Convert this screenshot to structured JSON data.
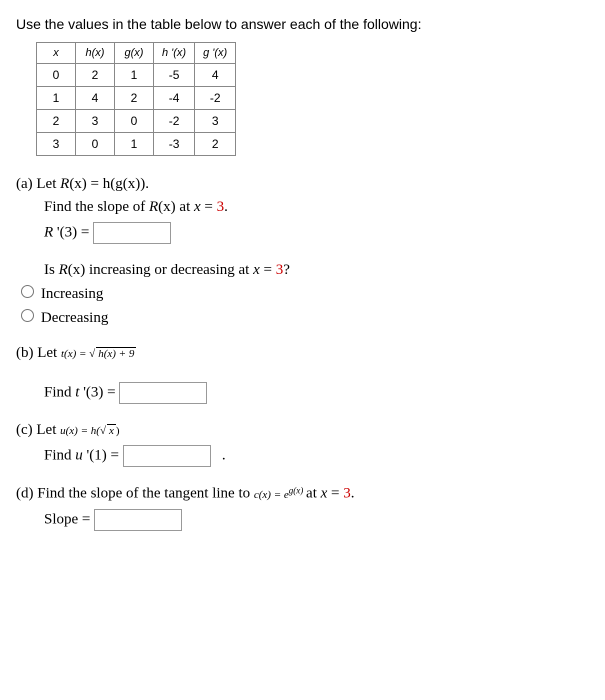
{
  "intro": "Use the values in the table below to answer each of the following:",
  "table": {
    "headers": [
      "x",
      "h(x)",
      "g(x)",
      "h '(x)",
      "g '(x)"
    ],
    "rows": [
      [
        "0",
        "2",
        "1",
        "-5",
        "4"
      ],
      [
        "1",
        "4",
        "2",
        "-4",
        "-2"
      ],
      [
        "2",
        "3",
        "0",
        "-2",
        "3"
      ],
      [
        "3",
        "0",
        "1",
        "-3",
        "2"
      ]
    ]
  },
  "parts": {
    "a": {
      "label": "(a) Let ",
      "def_pre": "R",
      "def_post": "(x) = h(g(x)).",
      "find_pre": "Find the slope of ",
      "find_mid": "R",
      "find_mid2": "(x) at ",
      "find_var": "x",
      "find_eq": " = ",
      "find_val": "3",
      "find_end": ".",
      "ans_lhs_r": "R ",
      "ans_lhs_rest": "'(3) = ",
      "q2_pre": "Is ",
      "q2_r": "R",
      "q2_mid": "(x) increasing or decreasing at ",
      "q2_var": "x",
      "q2_eq": " = ",
      "q2_val": "3",
      "q2_end": "?",
      "opt1": "Increasing",
      "opt2": "Decreasing"
    },
    "b": {
      "label": "(b) Let ",
      "formula_lhs": "t(x) = ",
      "formula_under": "h(x) + 9",
      "find_pre": "Find ",
      "find_t": "t ",
      "find_rest": "'(3) = "
    },
    "c": {
      "label": "(c) Let ",
      "formula_lhs": "u(x) = h(",
      "formula_under": "x",
      "formula_rhs": ")",
      "find_pre": "Find ",
      "find_u": "u ",
      "find_rest": "'(1) = ",
      "period": "."
    },
    "d": {
      "label": "(d) Find the slope of the tangent line to ",
      "formula_lhs": "c(x) = e",
      "formula_sup": "g(x)",
      "at": " at ",
      "var": "x",
      "eq": " = ",
      "val": "3",
      "end": ".",
      "ans_label": "Slope = "
    }
  },
  "chart_data": {
    "type": "table",
    "columns": [
      "x",
      "h(x)",
      "g(x)",
      "h'(x)",
      "g'(x)"
    ],
    "rows": [
      {
        "x": 0,
        "h(x)": 2,
        "g(x)": 1,
        "h'(x)": -5,
        "g'(x)": 4
      },
      {
        "x": 1,
        "h(x)": 4,
        "g(x)": 2,
        "h'(x)": -4,
        "g'(x)": -2
      },
      {
        "x": 2,
        "h(x)": 3,
        "g(x)": 0,
        "h'(x)": -2,
        "g'(x)": 3
      },
      {
        "x": 3,
        "h(x)": 0,
        "g(x)": 1,
        "h'(x)": -3,
        "g'(x)": 2
      }
    ]
  }
}
